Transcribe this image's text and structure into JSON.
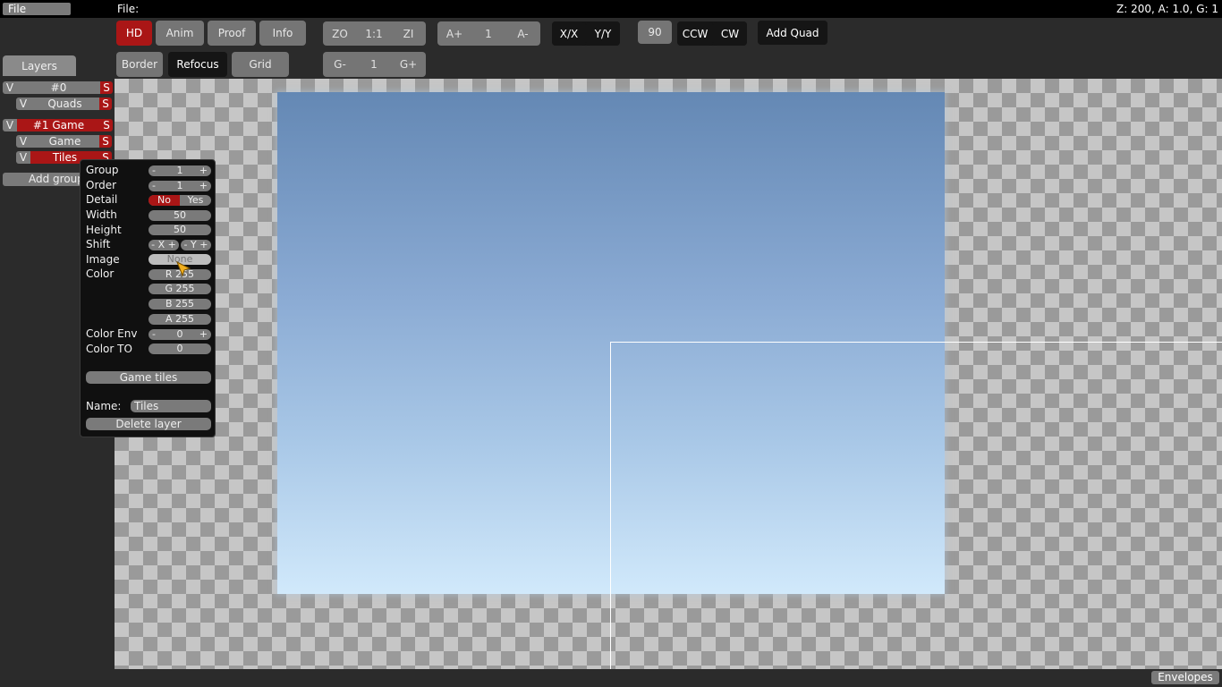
{
  "topbar": {
    "file_button": "File",
    "file_label": "File:",
    "status": "Z: 200, A: 1.0, G: 1"
  },
  "toolbar": {
    "hd": "HD",
    "anim": "Anim",
    "proof": "Proof",
    "info": "Info",
    "zoom_out": "ZO",
    "zoom_reset": "1:1",
    "zoom_in": "ZI",
    "anim_faster": "A+",
    "anim_speed": "1",
    "anim_slower": "A-",
    "flip_x": "X/X",
    "flip_y": "Y/Y",
    "rotation": "90",
    "ccw": "CCW",
    "cw": "CW",
    "add_quad": "Add Quad",
    "border": "Border",
    "refocus": "Refocus",
    "grid": "Grid",
    "grid_minus": "G-",
    "grid_value": "1",
    "grid_plus": "G+"
  },
  "layers": {
    "tab": "Layers",
    "visible_toggle": "V",
    "solo_toggle": "S",
    "group0": "#0",
    "quads": "Quads",
    "group1": "#1 Game",
    "game": "Game",
    "tiles": "Tiles",
    "add_group": "Add group"
  },
  "popup": {
    "group_label": "Group",
    "group_value": "1",
    "order_label": "Order",
    "order_value": "1",
    "detail_label": "Detail",
    "detail_no": "No",
    "detail_yes": "Yes",
    "width_label": "Width",
    "width_value": "50",
    "height_label": "Height",
    "height_value": "50",
    "shift_label": "Shift",
    "shift_x": "- X +",
    "shift_y": "- Y +",
    "image_label": "Image",
    "image_value": "None",
    "color_label": "Color",
    "r": "R 255",
    "g": "G 255",
    "b": "B 255",
    "a": "A 255",
    "color_env_label": "Color Env",
    "color_env_value": "0",
    "color_to_label": "Color TO",
    "color_to_value": "0",
    "game_tiles": "Game tiles",
    "name_label": "Name:",
    "name_value": "Tiles",
    "delete_layer": "Delete layer"
  },
  "bottombar": {
    "envelopes": "Envelopes"
  },
  "icons": {
    "cursor": "pointer-cursor-icon",
    "plus": "+",
    "minus": "-"
  },
  "colors": {
    "active_red": "#aa1616",
    "button_grey": "#757575",
    "cursor_yellow": "#f2b01e"
  }
}
